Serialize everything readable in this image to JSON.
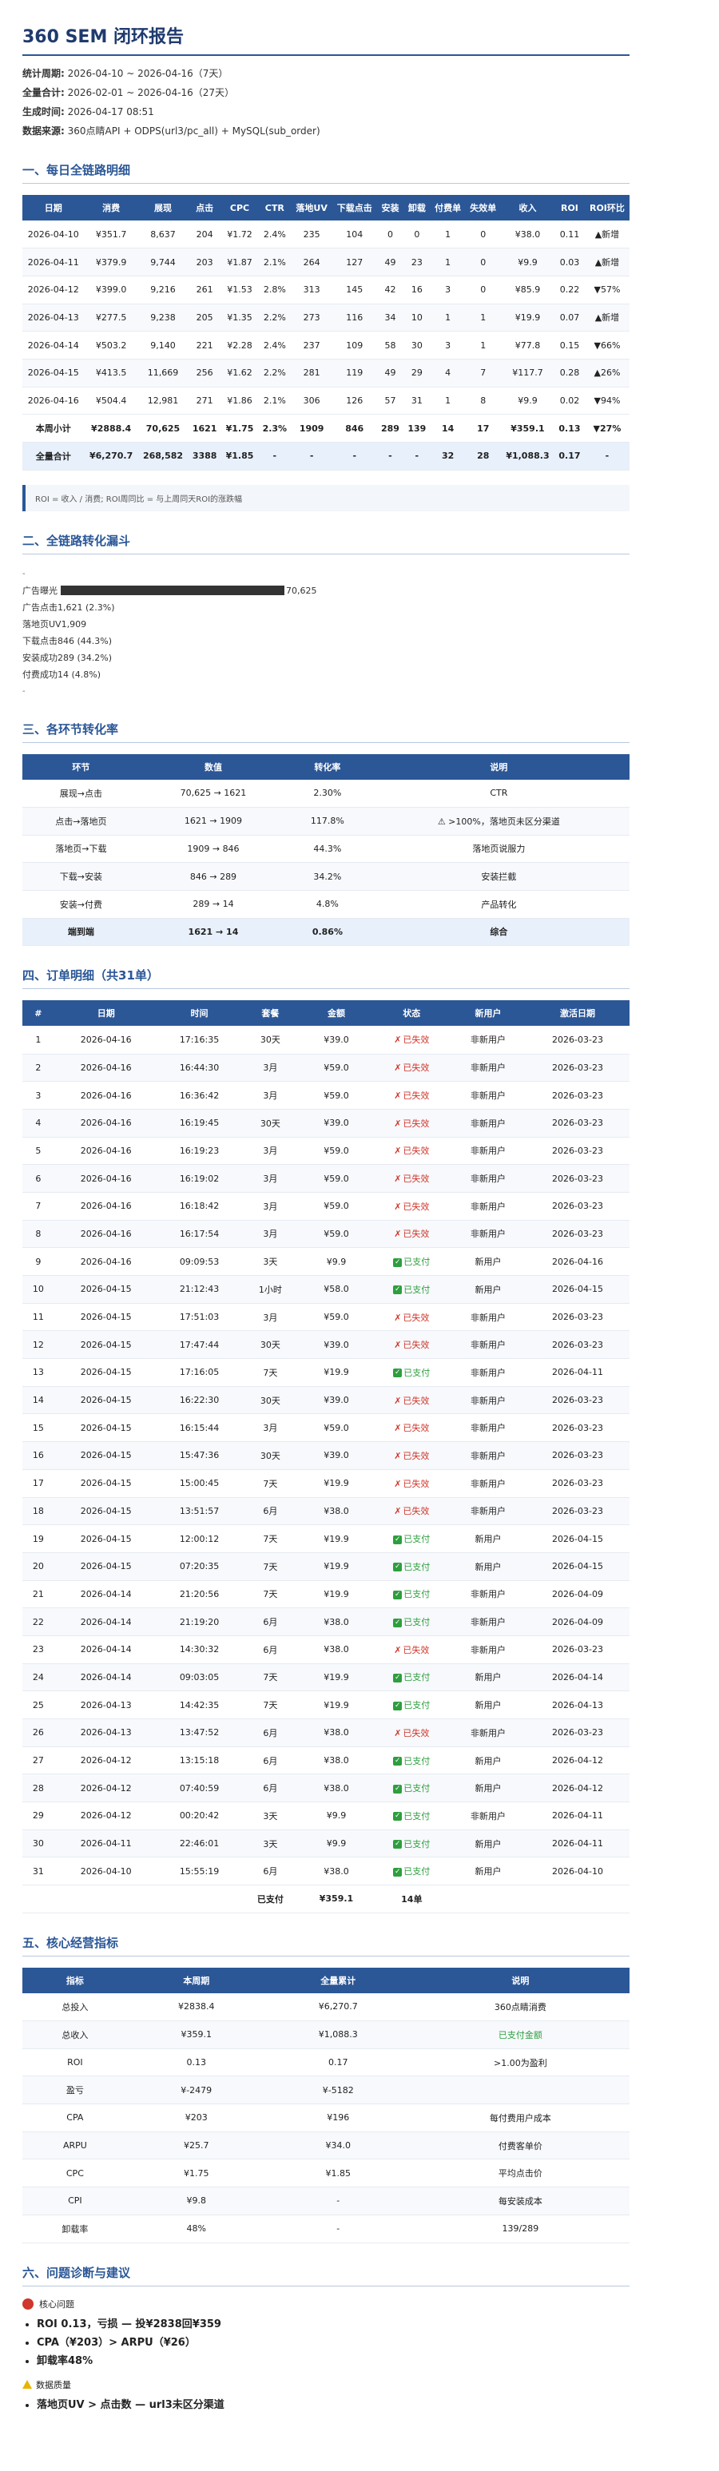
{
  "title": "360 SEM 闭环报告",
  "meta": [
    {
      "label": "统计周期:",
      "value": "2026-04-10 ~ 2026-04-16（7天）"
    },
    {
      "label": "全量合计:",
      "value": "2026-02-01 ~ 2026-04-16（27天）"
    },
    {
      "label": "生成时间:",
      "value": "2026-04-17 08:51"
    },
    {
      "label": "数据来源:",
      "value": "360点睛API + ODPS(url3/pc_all) + MySQL(sub_order)"
    }
  ],
  "s1": {
    "heading": "一、每日全链路明细",
    "headers": [
      "日期",
      "消费",
      "展现",
      "点击",
      "CPC",
      "CTR",
      "落地UV",
      "下载点击",
      "安装",
      "卸载",
      "付费单",
      "失效单",
      "收入",
      "ROI",
      "ROI环比"
    ],
    "rows": [
      [
        "2026-04-10",
        "¥351.7",
        "8,637",
        "204",
        "¥1.72",
        "2.4%",
        "235",
        "104",
        "0",
        "0",
        "1",
        "0",
        "¥38.0",
        "0.11",
        "▲新增"
      ],
      [
        "2026-04-11",
        "¥379.9",
        "9,744",
        "203",
        "¥1.87",
        "2.1%",
        "264",
        "127",
        "49",
        "23",
        "1",
        "0",
        "¥9.9",
        "0.03",
        "▲新增"
      ],
      [
        "2026-04-12",
        "¥399.0",
        "9,216",
        "261",
        "¥1.53",
        "2.8%",
        "313",
        "145",
        "42",
        "16",
        "3",
        "0",
        "¥85.9",
        "0.22",
        "▼57%"
      ],
      [
        "2026-04-13",
        "¥277.5",
        "9,238",
        "205",
        "¥1.35",
        "2.2%",
        "273",
        "116",
        "34",
        "10",
        "1",
        "1",
        "¥19.9",
        "0.07",
        "▲新增"
      ],
      [
        "2026-04-14",
        "¥503.2",
        "9,140",
        "221",
        "¥2.28",
        "2.4%",
        "237",
        "109",
        "58",
        "30",
        "3",
        "1",
        "¥77.8",
        "0.15",
        "▼66%"
      ],
      [
        "2026-04-15",
        "¥413.5",
        "11,669",
        "256",
        "¥1.62",
        "2.2%",
        "281",
        "119",
        "49",
        "29",
        "4",
        "7",
        "¥117.7",
        "0.28",
        "▲26%"
      ],
      [
        "2026-04-16",
        "¥504.4",
        "12,981",
        "271",
        "¥1.86",
        "2.1%",
        "306",
        "126",
        "57",
        "31",
        "1",
        "8",
        "¥9.9",
        "0.02",
        "▼94%"
      ]
    ],
    "subtotal": [
      "本周小计",
      "¥2888.4",
      "70,625",
      "1621",
      "¥1.75",
      "2.3%",
      "1909",
      "846",
      "289",
      "139",
      "14",
      "17",
      "¥359.1",
      "0.13",
      "▼27%"
    ],
    "total": [
      "全量合计",
      "¥6,270.7",
      "268,582",
      "3388",
      "¥1.85",
      "-",
      "-",
      "-",
      "-",
      "-",
      "32",
      "28",
      "¥1,088.3",
      "0.17",
      "-"
    ],
    "note": "ROI = 收入 / 消费; ROI周同比 = 与上周同天ROI的涨跌幅"
  },
  "s2": {
    "heading": "二、全链路转化漏斗",
    "dash": "-",
    "rows": [
      {
        "label": "广告曝光",
        "value": "70,625",
        "bar": 1.0
      },
      {
        "label": "广告点击",
        "value": "1,621 (2.3%)"
      },
      {
        "label": "落地页UV",
        "value": "1,909"
      },
      {
        "label": "下载点击",
        "value": "846 (44.3%)"
      },
      {
        "label": "安装成功",
        "value": "289 (34.2%)"
      },
      {
        "label": "付费成功",
        "value": "14 (4.8%)"
      }
    ]
  },
  "s3": {
    "heading": "三、各环节转化率",
    "headers": [
      "环节",
      "数值",
      "转化率",
      "说明"
    ],
    "rows": [
      [
        "展现→点击",
        "70,625 → 1621",
        "2.30%",
        "CTR"
      ],
      [
        "点击→落地页",
        "1621 → 1909",
        "117.8%",
        "⚠ >100%，落地页未区分渠道"
      ],
      [
        "落地页→下载",
        "1909 → 846",
        "44.3%",
        "落地页说服力"
      ],
      [
        "下载→安装",
        "846 → 289",
        "34.2%",
        "安装拦截"
      ],
      [
        "安装→付费",
        "289 → 14",
        "4.8%",
        "产品转化"
      ]
    ],
    "total": [
      "端到端",
      "1621 → 14",
      "0.86%",
      "综合"
    ]
  },
  "s4": {
    "heading": "四、订单明细（共31单）",
    "headers": [
      "#",
      "日期",
      "时间",
      "套餐",
      "金额",
      "状态",
      "新用户",
      "激活日期"
    ],
    "rows": [
      [
        "1",
        "2026-04-16",
        "17:16:35",
        "30天",
        "¥39.0",
        "已失效",
        "非新用户",
        "2026-03-23"
      ],
      [
        "2",
        "2026-04-16",
        "16:44:30",
        "3月",
        "¥59.0",
        "已失效",
        "非新用户",
        "2026-03-23"
      ],
      [
        "3",
        "2026-04-16",
        "16:36:42",
        "3月",
        "¥59.0",
        "已失效",
        "非新用户",
        "2026-03-23"
      ],
      [
        "4",
        "2026-04-16",
        "16:19:45",
        "30天",
        "¥39.0",
        "已失效",
        "非新用户",
        "2026-03-23"
      ],
      [
        "5",
        "2026-04-16",
        "16:19:23",
        "3月",
        "¥59.0",
        "已失效",
        "非新用户",
        "2026-03-23"
      ],
      [
        "6",
        "2026-04-16",
        "16:19:02",
        "3月",
        "¥59.0",
        "已失效",
        "非新用户",
        "2026-03-23"
      ],
      [
        "7",
        "2026-04-16",
        "16:18:42",
        "3月",
        "¥59.0",
        "已失效",
        "非新用户",
        "2026-03-23"
      ],
      [
        "8",
        "2026-04-16",
        "16:17:54",
        "3月",
        "¥59.0",
        "已失效",
        "非新用户",
        "2026-03-23"
      ],
      [
        "9",
        "2026-04-16",
        "09:09:53",
        "3天",
        "¥9.9",
        "已支付",
        "新用户",
        "2026-04-16"
      ],
      [
        "10",
        "2026-04-15",
        "21:12:43",
        "1小时",
        "¥58.0",
        "已支付",
        "新用户",
        "2026-04-15"
      ],
      [
        "11",
        "2026-04-15",
        "17:51:03",
        "3月",
        "¥59.0",
        "已失效",
        "非新用户",
        "2026-03-23"
      ],
      [
        "12",
        "2026-04-15",
        "17:47:44",
        "30天",
        "¥39.0",
        "已失效",
        "非新用户",
        "2026-03-23"
      ],
      [
        "13",
        "2026-04-15",
        "17:16:05",
        "7天",
        "¥19.9",
        "已支付",
        "非新用户",
        "2026-04-11"
      ],
      [
        "14",
        "2026-04-15",
        "16:22:30",
        "30天",
        "¥39.0",
        "已失效",
        "非新用户",
        "2026-03-23"
      ],
      [
        "15",
        "2026-04-15",
        "16:15:44",
        "3月",
        "¥59.0",
        "已失效",
        "非新用户",
        "2026-03-23"
      ],
      [
        "16",
        "2026-04-15",
        "15:47:36",
        "30天",
        "¥39.0",
        "已失效",
        "非新用户",
        "2026-03-23"
      ],
      [
        "17",
        "2026-04-15",
        "15:00:45",
        "7天",
        "¥19.9",
        "已失效",
        "非新用户",
        "2026-03-23"
      ],
      [
        "18",
        "2026-04-15",
        "13:51:57",
        "6月",
        "¥38.0",
        "已失效",
        "非新用户",
        "2026-03-23"
      ],
      [
        "19",
        "2026-04-15",
        "12:00:12",
        "7天",
        "¥19.9",
        "已支付",
        "新用户",
        "2026-04-15"
      ],
      [
        "20",
        "2026-04-15",
        "07:20:35",
        "7天",
        "¥19.9",
        "已支付",
        "新用户",
        "2026-04-15"
      ],
      [
        "21",
        "2026-04-14",
        "21:20:56",
        "7天",
        "¥19.9",
        "已支付",
        "非新用户",
        "2026-04-09"
      ],
      [
        "22",
        "2026-04-14",
        "21:19:20",
        "6月",
        "¥38.0",
        "已支付",
        "非新用户",
        "2026-04-09"
      ],
      [
        "23",
        "2026-04-14",
        "14:30:32",
        "6月",
        "¥38.0",
        "已失效",
        "非新用户",
        "2026-03-23"
      ],
      [
        "24",
        "2026-04-14",
        "09:03:05",
        "7天",
        "¥19.9",
        "已支付",
        "新用户",
        "2026-04-14"
      ],
      [
        "25",
        "2026-04-13",
        "14:42:35",
        "7天",
        "¥19.9",
        "已支付",
        "新用户",
        "2026-04-13"
      ],
      [
        "26",
        "2026-04-13",
        "13:47:52",
        "6月",
        "¥38.0",
        "已失效",
        "非新用户",
        "2026-03-23"
      ],
      [
        "27",
        "2026-04-12",
        "13:15:18",
        "6月",
        "¥38.0",
        "已支付",
        "新用户",
        "2026-04-12"
      ],
      [
        "28",
        "2026-04-12",
        "07:40:59",
        "6月",
        "¥38.0",
        "已支付",
        "新用户",
        "2026-04-12"
      ],
      [
        "29",
        "2026-04-12",
        "00:20:42",
        "3天",
        "¥9.9",
        "已支付",
        "非新用户",
        "2026-04-11"
      ],
      [
        "30",
        "2026-04-11",
        "22:46:01",
        "3天",
        "¥9.9",
        "已支付",
        "新用户",
        "2026-04-11"
      ],
      [
        "31",
        "2026-04-10",
        "15:55:19",
        "6月",
        "¥38.0",
        "已支付",
        "新用户",
        "2026-04-10"
      ]
    ],
    "footer": {
      "label": "已支付",
      "amount": "¥359.1",
      "count": "14单"
    }
  },
  "s5": {
    "heading": "五、核心经营指标",
    "headers": [
      "指标",
      "本周期",
      "全量累计",
      "说明"
    ],
    "rows": [
      [
        "总投入",
        "¥2838.4",
        "¥6,270.7",
        "360点睛消费"
      ],
      [
        "总收入",
        "¥359.1",
        "¥1,088.3",
        "已支付金额"
      ],
      [
        "ROI",
        "0.13",
        "0.17",
        ">1.00为盈利"
      ],
      [
        "盈亏",
        "¥-2479",
        "¥-5182",
        ""
      ],
      [
        "CPA",
        "¥203",
        "¥196",
        "每付费用户成本"
      ],
      [
        "ARPU",
        "¥25.7",
        "¥34.0",
        "付费客单价"
      ],
      [
        "CPC",
        "¥1.75",
        "¥1.85",
        "平均点击价"
      ],
      [
        "CPI",
        "¥9.8",
        "-",
        "每安装成本"
      ],
      [
        "卸载率",
        "48%",
        "-",
        "139/289"
      ]
    ]
  },
  "s6": {
    "heading": "六、问题诊断与建议",
    "core_title": "核心问题",
    "core_items": [
      "ROI 0.13，亏损 — 投¥2838回¥359",
      "CPA（¥203）> ARPU（¥26）",
      "卸载率48%"
    ],
    "data_title": "数据质量",
    "data_items": [
      "落地页UV > 点击数 — url3未区分渠道"
    ]
  },
  "colors": {
    "header": "#2b5797",
    "paid": "#2e9e3e",
    "void": "#d0362b"
  }
}
